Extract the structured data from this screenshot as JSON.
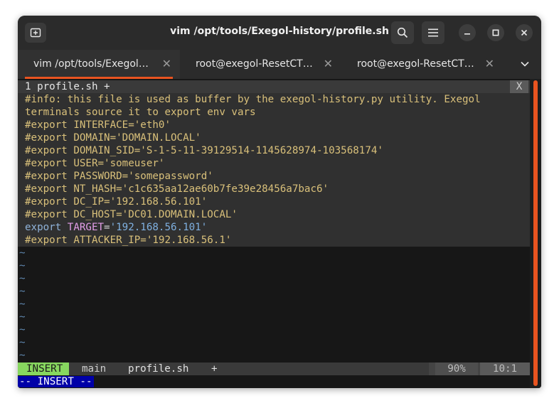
{
  "window": {
    "title": "vim /opt/tools/Exegol-history/profile.sh"
  },
  "tabs": [
    {
      "label": "vim /opt/tools/Exegol…",
      "active": true
    },
    {
      "label": "root@exegol-ResetCT…",
      "active": false
    },
    {
      "label": "root@exegol-ResetCT…",
      "active": false
    }
  ],
  "vim": {
    "buffer_tab": "1 profile.sh +",
    "buffer_close": "X",
    "lines": [
      "#info: this file is used as buffer by the exegol-history.py utility. Exegol",
      "terminals source it to export env vars",
      "#export INTERFACE='eth0'",
      "#export DOMAIN='DOMAIN.LOCAL'",
      "#export DOMAIN_SID='S-1-5-11-39129514-1145628974-103568174'",
      "#export USER='someuser'",
      "#export PASSWORD='somepassword'",
      "#export NT_HASH='c1c635aa12ae60b7fe39e28456a7bac6'",
      "#export DC_IP='192.168.56.101'",
      "#export DC_HOST='DC01.DOMAIN.LOCAL'"
    ],
    "active_line": {
      "kw": "export",
      "var": "TARGET",
      "op": "=",
      "str": "'192.168.56.101'"
    },
    "last_line": "#export ATTACKER_IP='192.168.56.1'",
    "tilde": "~",
    "status": {
      "mode": "INSERT",
      "branch": "main",
      "file": "profile.sh",
      "modified": "+",
      "percent": "90%",
      "position": "10:1"
    },
    "cmdline": "-- INSERT --"
  },
  "colors": {
    "accent": "#e95420",
    "comment": "#d9c07a",
    "mode_bg": "#87d75f",
    "cmd_bg": "#0000a8"
  }
}
